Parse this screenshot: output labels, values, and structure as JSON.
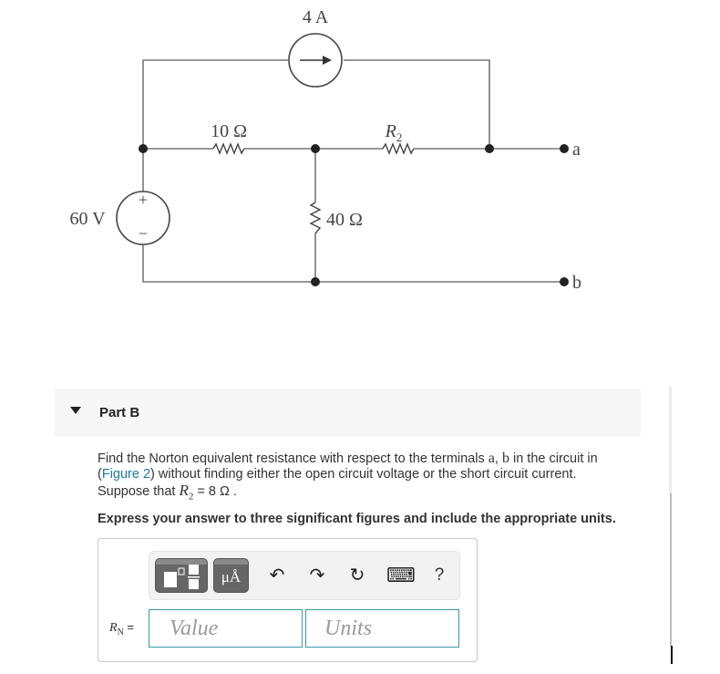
{
  "figure": {
    "current_source_label": "4 A",
    "voltage_source_label": "60 V",
    "resistor_10_label": "10 Ω",
    "resistor_r2_label": "R",
    "resistor_r2_sub": "2",
    "resistor_40_label": "40 Ω",
    "terminal_a": "a",
    "terminal_b": "b",
    "plus_sign": "+",
    "minus_sign": "−"
  },
  "part": {
    "title": "Part B",
    "expanded": true
  },
  "question": {
    "text_1": "Find the Norton equivalent resistance with respect to the terminals ",
    "terminal_a": "a",
    "comma": ", ",
    "terminal_b": "b",
    "text_2": " in the circuit in",
    "paren_open": "(",
    "figure_link": "Figure 2",
    "text_3": ") without finding either the open circuit voltage or the short circuit current.",
    "text_4": "Suppose that ",
    "var": "R",
    "var_sub": "2",
    "text_5": " = 8  Ω .",
    "instruction": "Express your answer to three significant figures and include the appropriate units."
  },
  "answer": {
    "label_var": "R",
    "label_sub": "N",
    "label_eq": " =",
    "value_placeholder": "Value",
    "units_placeholder": "Units",
    "toolbar": {
      "templates_icon": "templates-icon",
      "units_label": "μÅ",
      "undo_glyph": "↶",
      "redo_glyph": "↷",
      "reset_glyph": "↻",
      "keyboard_glyph": "⌨",
      "help_glyph": "?"
    }
  }
}
